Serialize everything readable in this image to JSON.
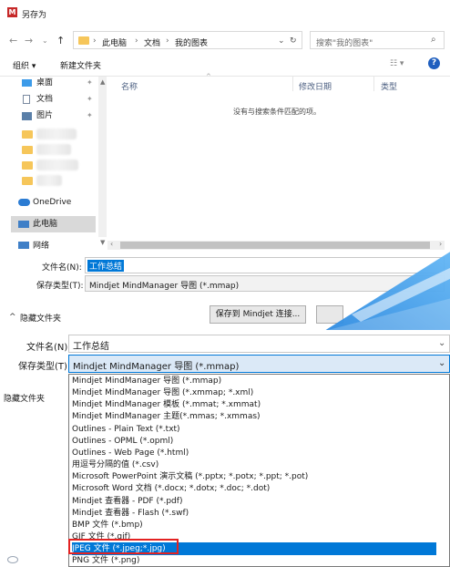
{
  "window": {
    "title": "另存为"
  },
  "address": {
    "crumbs": [
      "此电脑",
      "文档",
      "我的图表"
    ],
    "search_placeholder": "搜索\"我的图表\""
  },
  "toolbar": {
    "organize": "组织 ▾",
    "new_folder": "新建文件夹"
  },
  "sidebar": {
    "items": [
      {
        "label": "桌面",
        "icon": "desktop-icon"
      },
      {
        "label": "文档",
        "icon": "document-icon"
      },
      {
        "label": "图片",
        "icon": "picture-icon"
      },
      {
        "label": "OneDrive",
        "icon": "cloud-icon"
      },
      {
        "label": "此电脑",
        "icon": "computer-icon"
      },
      {
        "label": "网络",
        "icon": "network-icon"
      }
    ]
  },
  "columns": {
    "name": "名称",
    "modified": "修改日期",
    "type": "类型"
  },
  "empty_message": "没有与搜索条件匹配的项。",
  "form": {
    "filename_label": "文件名(N):",
    "filename_value": "工作总结",
    "filetype_label": "保存类型(T):",
    "filetype_value": "Mindjet MindManager 导图 (*.mmap)",
    "save_to_mindjet": "保存到 Mindjet 连接...",
    "hide_folders": "隐藏文件夹"
  },
  "overlay_form": {
    "filename_label": "文件名(N):",
    "filename_value": "工作总结",
    "filetype_label": "保存类型(T):",
    "filetype_value": "Mindjet MindManager 导图 (*.mmap)",
    "hide_folders": "隐藏文件夹"
  },
  "dropdown_options": [
    "Mindjet MindManager 导图 (*.mmap)",
    "Mindjet MindManager 导图 (*.xmmap; *.xml)",
    "Mindjet MindManager 模板 (*.mmat; *.xmmat)",
    "Mindjet MindManager 主题(*.mmas; *.xmmas)",
    "Outlines - Plain Text (*.txt)",
    "Outlines - OPML (*.opml)",
    "Outlines - Web Page (*.html)",
    "用逗号分隔的值 (*.csv)",
    "Microsoft PowerPoint 演示文稿 (*.pptx; *.potx; *.ppt; *.pot)",
    "Microsoft Word 文档 (*.docx; *.dotx; *.doc; *.dot)",
    "Mindjet 查看器 - PDF (*.pdf)",
    "Mindjet 查看器 - Flash (*.swf)",
    "BMP 文件 (*.bmp)",
    "GIF 文件 (*.gif)",
    "JPEG 文件 (*.jpeg;*.jpg)",
    "PNG 文件 (*.png)"
  ],
  "selected_option_index": 14,
  "colors": {
    "selection": "#0078d7",
    "highlight_box": "#e32222",
    "overlay": "#1e88e5"
  }
}
